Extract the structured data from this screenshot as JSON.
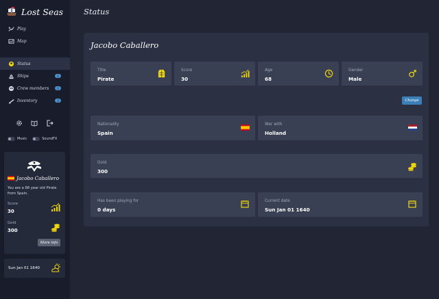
{
  "app": {
    "title": "Lost Seas"
  },
  "colors": {
    "accent": "#f2d60d",
    "button": "#3c7fb7",
    "badge": "#4a8fc9"
  },
  "nav_top": [
    {
      "label": "Play",
      "icon": "play-icon"
    },
    {
      "label": "Map",
      "icon": "map-icon"
    }
  ],
  "nav_main": [
    {
      "label": "Status",
      "icon": "status-icon",
      "active": true
    },
    {
      "label": "Ships",
      "icon": "ship-icon",
      "badge": "1"
    },
    {
      "label": "Crew members",
      "icon": "crew-icon",
      "badge": "2"
    },
    {
      "label": "Inventory",
      "icon": "inventory-icon",
      "badge": "3"
    }
  ],
  "tools": [
    "settings-icon",
    "book-icon",
    "logout-icon"
  ],
  "toggles": {
    "music": "Music",
    "soundfx": "SoundFX"
  },
  "player_card": {
    "name": "Jacobo Caballero",
    "description": "You are a 68 year old Pirate from Spain.",
    "score_label": "Score",
    "score": "30",
    "gold_label": "Gold",
    "gold": "300",
    "more_info": "More info"
  },
  "date_card": {
    "date": "Sun Jan 01 1640",
    "icon": "weather-icon"
  },
  "page": {
    "title": "Status"
  },
  "status": {
    "name": "Jacobo Caballero",
    "title_label": "Title",
    "title_value": "Pirate",
    "score_label": "Score",
    "score_value": "30",
    "age_label": "Age",
    "age_value": "68",
    "gender_label": "Gender",
    "gender_value": "Male",
    "change_label": "Change",
    "nationality_label": "Nationality",
    "nationality_value": "Spain",
    "war_label": "War with",
    "war_value": "Holland",
    "gold_label": "Gold",
    "gold_value": "300",
    "playing_label": "Has been playing for",
    "playing_value": "0 days",
    "date_label": "Current date",
    "date_value": "Sun Jan 01 1640"
  }
}
